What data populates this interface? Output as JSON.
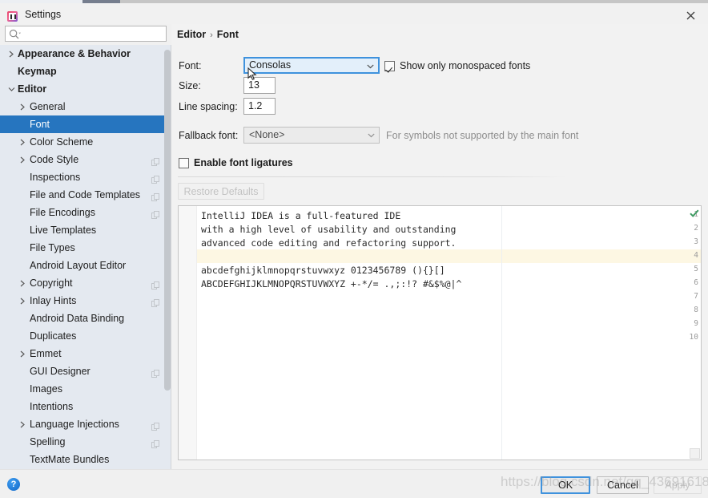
{
  "window": {
    "title": "Settings",
    "close_label": "✕",
    "app_icon": "intellij-idea-icon"
  },
  "search": {
    "value": "",
    "placeholder": "",
    "icon": "search-icon"
  },
  "sidebar": {
    "items": [
      {
        "label": "Appearance & Behavior",
        "indent": 0,
        "arrow": "collapsed",
        "bold": true,
        "badge": false,
        "selected": false
      },
      {
        "label": "Keymap",
        "indent": 0,
        "arrow": "none",
        "bold": true,
        "badge": false,
        "selected": false
      },
      {
        "label": "Editor",
        "indent": 0,
        "arrow": "expanded",
        "bold": true,
        "badge": false,
        "selected": false
      },
      {
        "label": "General",
        "indent": 1,
        "arrow": "collapsed",
        "bold": false,
        "badge": false,
        "selected": false
      },
      {
        "label": "Font",
        "indent": 1,
        "arrow": "none",
        "bold": false,
        "badge": false,
        "selected": true
      },
      {
        "label": "Color Scheme",
        "indent": 1,
        "arrow": "collapsed",
        "bold": false,
        "badge": false,
        "selected": false
      },
      {
        "label": "Code Style",
        "indent": 1,
        "arrow": "collapsed",
        "bold": false,
        "badge": true,
        "selected": false
      },
      {
        "label": "Inspections",
        "indent": 1,
        "arrow": "none",
        "bold": false,
        "badge": true,
        "selected": false
      },
      {
        "label": "File and Code Templates",
        "indent": 1,
        "arrow": "none",
        "bold": false,
        "badge": true,
        "selected": false
      },
      {
        "label": "File Encodings",
        "indent": 1,
        "arrow": "none",
        "bold": false,
        "badge": true,
        "selected": false
      },
      {
        "label": "Live Templates",
        "indent": 1,
        "arrow": "none",
        "bold": false,
        "badge": false,
        "selected": false
      },
      {
        "label": "File Types",
        "indent": 1,
        "arrow": "none",
        "bold": false,
        "badge": false,
        "selected": false
      },
      {
        "label": "Android Layout Editor",
        "indent": 1,
        "arrow": "none",
        "bold": false,
        "badge": false,
        "selected": false
      },
      {
        "label": "Copyright",
        "indent": 1,
        "arrow": "collapsed",
        "bold": false,
        "badge": true,
        "selected": false
      },
      {
        "label": "Inlay Hints",
        "indent": 1,
        "arrow": "collapsed",
        "bold": false,
        "badge": true,
        "selected": false
      },
      {
        "label": "Android Data Binding",
        "indent": 1,
        "arrow": "none",
        "bold": false,
        "badge": false,
        "selected": false
      },
      {
        "label": "Duplicates",
        "indent": 1,
        "arrow": "none",
        "bold": false,
        "badge": false,
        "selected": false
      },
      {
        "label": "Emmet",
        "indent": 1,
        "arrow": "collapsed",
        "bold": false,
        "badge": false,
        "selected": false
      },
      {
        "label": "GUI Designer",
        "indent": 1,
        "arrow": "none",
        "bold": false,
        "badge": true,
        "selected": false
      },
      {
        "label": "Images",
        "indent": 1,
        "arrow": "none",
        "bold": false,
        "badge": false,
        "selected": false
      },
      {
        "label": "Intentions",
        "indent": 1,
        "arrow": "none",
        "bold": false,
        "badge": false,
        "selected": false
      },
      {
        "label": "Language Injections",
        "indent": 1,
        "arrow": "collapsed",
        "bold": false,
        "badge": true,
        "selected": false
      },
      {
        "label": "Spelling",
        "indent": 1,
        "arrow": "none",
        "bold": false,
        "badge": true,
        "selected": false
      },
      {
        "label": "TextMate Bundles",
        "indent": 1,
        "arrow": "none",
        "bold": false,
        "badge": false,
        "selected": false
      }
    ]
  },
  "breadcrumb": {
    "root": "Editor",
    "separator": "›",
    "leaf": "Font"
  },
  "form": {
    "font_label": "Font:",
    "font_value": "Consolas",
    "size_label": "Size:",
    "size_value": "13",
    "line_spacing_label": "Line spacing:",
    "line_spacing_value": "1.2",
    "fallback_label": "Fallback font:",
    "fallback_value": "<None>",
    "fallback_hint": "For symbols not supported by the main font",
    "monospaced_label": "Show only monospaced fonts",
    "monospaced_checked": true,
    "ligatures_label": "Enable font ligatures",
    "ligatures_checked": false,
    "restore_defaults_label": "Restore Defaults",
    "restore_defaults_enabled": false
  },
  "preview": {
    "gutter_numbers": [
      "1",
      "2",
      "3",
      "4",
      "5",
      "6",
      "7",
      "8",
      "9",
      "10"
    ],
    "caret_line_number": 4,
    "lines": [
      "IntelliJ IDEA is a full-featured IDE",
      "with a high level of usability and outstanding",
      "advanced code editing and refactoring support.",
      "",
      "abcdefghijklmnopqrstuvwxyz 0123456789 (){}[]",
      "ABCDEFGHIJKLMNOPQRSTUVWXYZ +-*/= .,;:!? #&$%@|^"
    ],
    "inspection_icon": "green-checkmark-icon"
  },
  "footer": {
    "help_label": "?",
    "ok_label": "OK",
    "cancel_label": "Cancel",
    "apply_label": "Apply",
    "apply_enabled": false
  },
  "watermark": {
    "text": "https://blog.csdn.net/qq_43691618"
  },
  "colors": {
    "accent": "#2675bf",
    "focus_border": "#3f92dd",
    "sidebar_bg": "#e4e9f0",
    "content_bg": "#f2f2f2",
    "caret_line": "#fdf7e3"
  }
}
